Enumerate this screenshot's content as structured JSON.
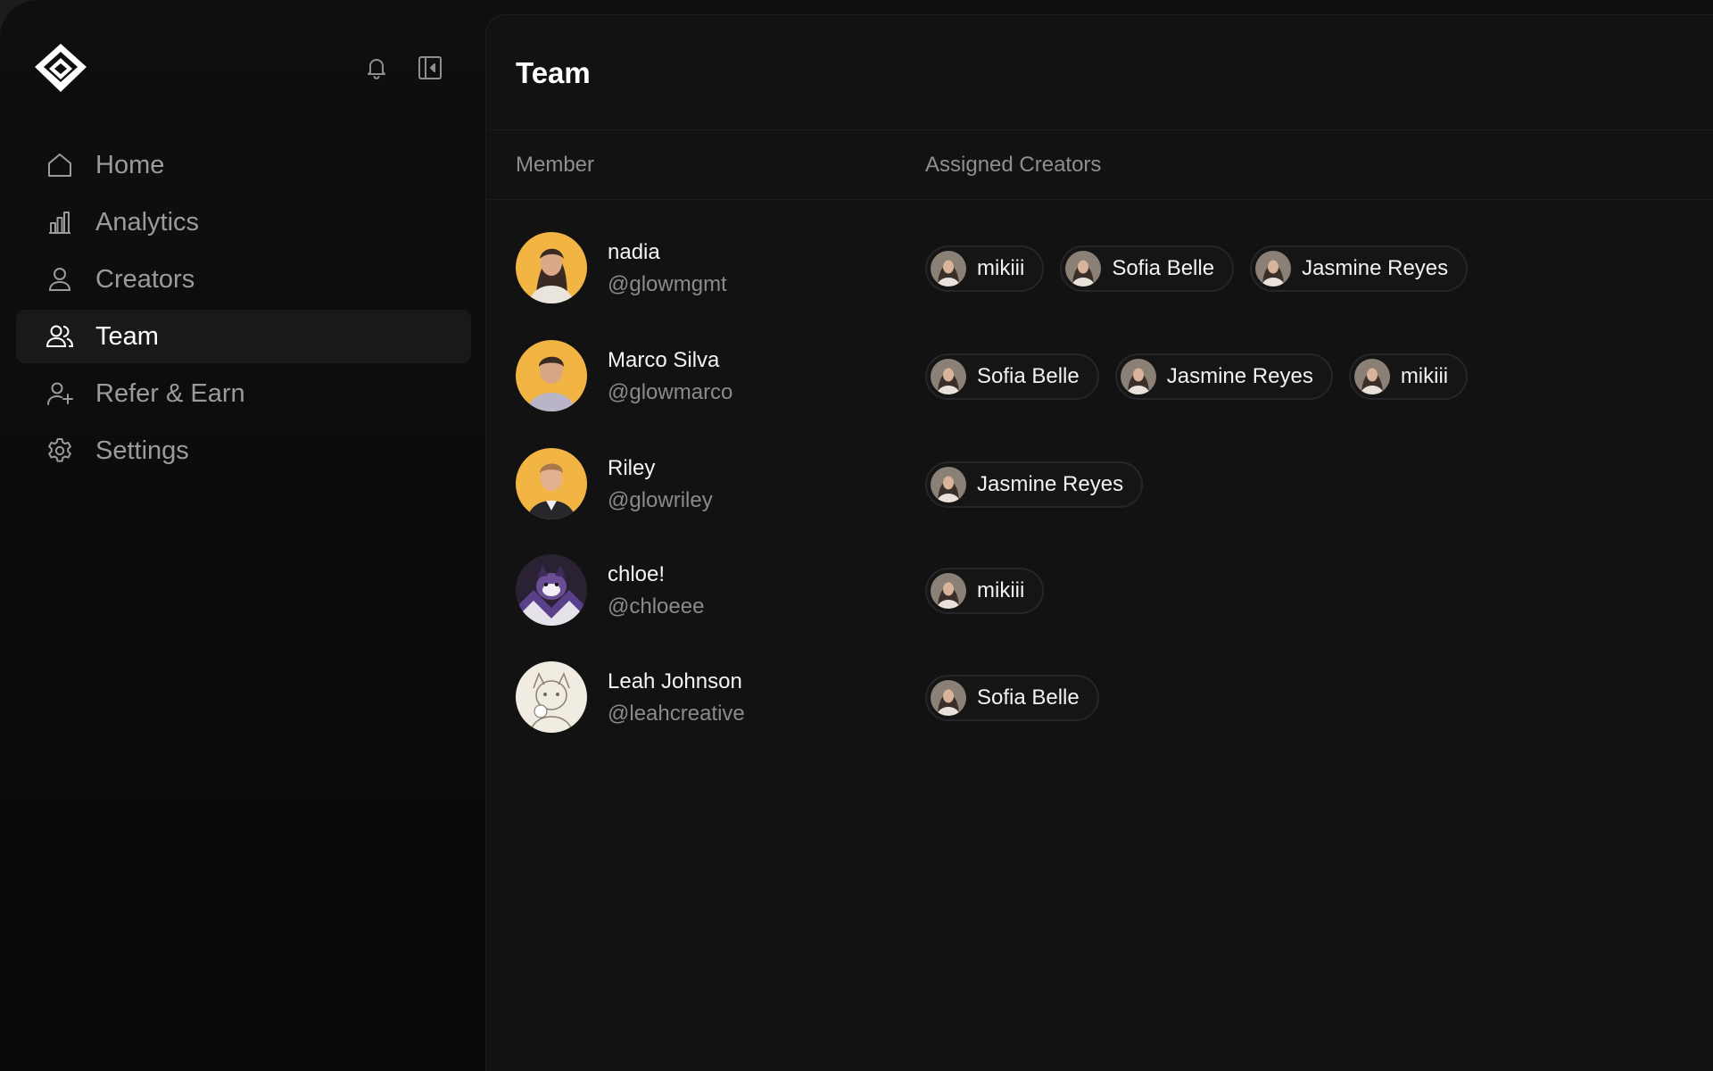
{
  "sidebar": {
    "logo_icon": "diamond-logo-icon",
    "notifications_icon": "bell-icon",
    "collapse_icon": "sidebar-collapse-icon",
    "items": [
      {
        "label": "Home",
        "icon": "home-icon",
        "active": false
      },
      {
        "label": "Analytics",
        "icon": "bar-chart-icon",
        "active": false
      },
      {
        "label": "Creators",
        "icon": "user-icon",
        "active": false
      },
      {
        "label": "Team",
        "icon": "users-icon",
        "active": true
      },
      {
        "label": "Refer & Earn",
        "icon": "user-plus-icon",
        "active": false
      },
      {
        "label": "Settings",
        "icon": "gear-icon",
        "active": false
      }
    ]
  },
  "main": {
    "title": "Team",
    "columns": {
      "member": "Member",
      "assigned": "Assigned Creators"
    },
    "members": [
      {
        "name": "nadia",
        "handle": "@glowmgmt",
        "creators": [
          "mikiii",
          "Sofia Belle",
          "Jasmine Reyes"
        ]
      },
      {
        "name": "Marco Silva",
        "handle": "@glowmarco",
        "creators": [
          "Sofia Belle",
          "Jasmine Reyes",
          "mikiii"
        ]
      },
      {
        "name": "Riley",
        "handle": "@glowriley",
        "creators": [
          "Jasmine Reyes"
        ]
      },
      {
        "name": "chloe!",
        "handle": "@chloeee",
        "creators": [
          "mikiii"
        ]
      },
      {
        "name": "Leah Johnson",
        "handle": "@leahcreative",
        "creators": [
          "Sofia Belle"
        ]
      }
    ]
  },
  "colors": {
    "background": "#0f0f0f",
    "panel": "#121212",
    "active_nav": "#19191a",
    "avatar_yellow": "#f2b544",
    "muted_text": "#8e8e93"
  }
}
